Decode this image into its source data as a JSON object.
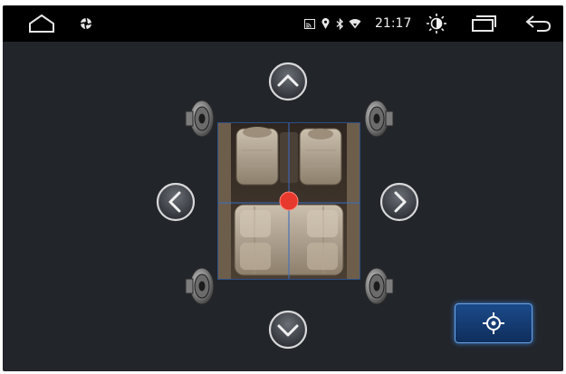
{
  "status_bar": {
    "time": "21:17",
    "icons": [
      "home-icon",
      "settings-icon",
      "cast-icon",
      "location-icon",
      "bluetooth-icon",
      "wifi-icon",
      "brightness-icon",
      "recent-apps-icon",
      "back-icon"
    ]
  },
  "balance_fader": {
    "controls": [
      "up-arrow",
      "left-arrow",
      "right-arrow",
      "down-arrow",
      "center-button"
    ],
    "speakers": [
      "front-left",
      "front-right",
      "rear-left",
      "rear-right"
    ],
    "position": {
      "horizontal": 0.5,
      "vertical": 0.5
    }
  },
  "colors": {
    "background": "#22252a",
    "status_bar": "#000000",
    "point": "#e8392f",
    "grid_line": "#3a6cc2",
    "button": "#1b4a8a"
  }
}
